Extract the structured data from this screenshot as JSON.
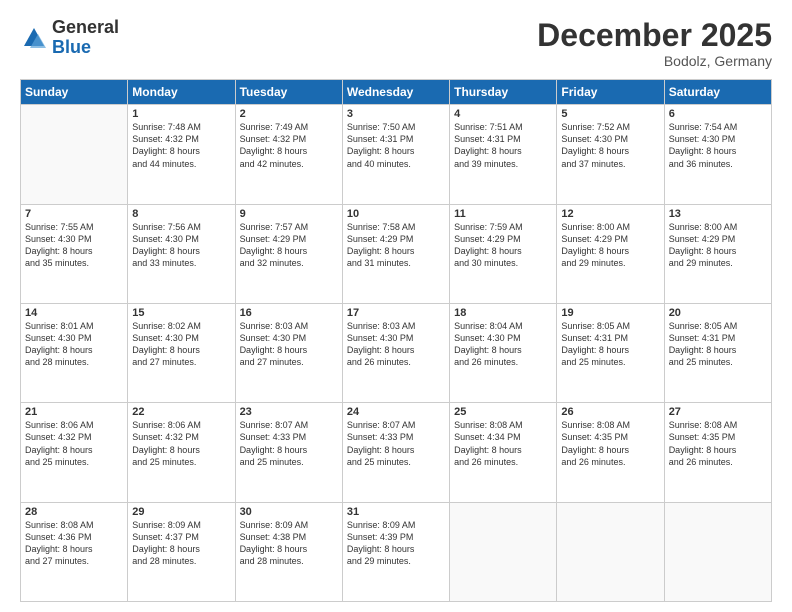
{
  "header": {
    "logo_general": "General",
    "logo_blue": "Blue",
    "month_title": "December 2025",
    "location": "Bodolz, Germany"
  },
  "days_of_week": [
    "Sunday",
    "Monday",
    "Tuesday",
    "Wednesday",
    "Thursday",
    "Friday",
    "Saturday"
  ],
  "weeks": [
    [
      {
        "day": "",
        "content": ""
      },
      {
        "day": "1",
        "content": "Sunrise: 7:48 AM\nSunset: 4:32 PM\nDaylight: 8 hours\nand 44 minutes."
      },
      {
        "day": "2",
        "content": "Sunrise: 7:49 AM\nSunset: 4:32 PM\nDaylight: 8 hours\nand 42 minutes."
      },
      {
        "day": "3",
        "content": "Sunrise: 7:50 AM\nSunset: 4:31 PM\nDaylight: 8 hours\nand 40 minutes."
      },
      {
        "day": "4",
        "content": "Sunrise: 7:51 AM\nSunset: 4:31 PM\nDaylight: 8 hours\nand 39 minutes."
      },
      {
        "day": "5",
        "content": "Sunrise: 7:52 AM\nSunset: 4:30 PM\nDaylight: 8 hours\nand 37 minutes."
      },
      {
        "day": "6",
        "content": "Sunrise: 7:54 AM\nSunset: 4:30 PM\nDaylight: 8 hours\nand 36 minutes."
      }
    ],
    [
      {
        "day": "7",
        "content": "Sunrise: 7:55 AM\nSunset: 4:30 PM\nDaylight: 8 hours\nand 35 minutes."
      },
      {
        "day": "8",
        "content": "Sunrise: 7:56 AM\nSunset: 4:30 PM\nDaylight: 8 hours\nand 33 minutes."
      },
      {
        "day": "9",
        "content": "Sunrise: 7:57 AM\nSunset: 4:29 PM\nDaylight: 8 hours\nand 32 minutes."
      },
      {
        "day": "10",
        "content": "Sunrise: 7:58 AM\nSunset: 4:29 PM\nDaylight: 8 hours\nand 31 minutes."
      },
      {
        "day": "11",
        "content": "Sunrise: 7:59 AM\nSunset: 4:29 PM\nDaylight: 8 hours\nand 30 minutes."
      },
      {
        "day": "12",
        "content": "Sunrise: 8:00 AM\nSunset: 4:29 PM\nDaylight: 8 hours\nand 29 minutes."
      },
      {
        "day": "13",
        "content": "Sunrise: 8:00 AM\nSunset: 4:29 PM\nDaylight: 8 hours\nand 29 minutes."
      }
    ],
    [
      {
        "day": "14",
        "content": "Sunrise: 8:01 AM\nSunset: 4:30 PM\nDaylight: 8 hours\nand 28 minutes."
      },
      {
        "day": "15",
        "content": "Sunrise: 8:02 AM\nSunset: 4:30 PM\nDaylight: 8 hours\nand 27 minutes."
      },
      {
        "day": "16",
        "content": "Sunrise: 8:03 AM\nSunset: 4:30 PM\nDaylight: 8 hours\nand 27 minutes."
      },
      {
        "day": "17",
        "content": "Sunrise: 8:03 AM\nSunset: 4:30 PM\nDaylight: 8 hours\nand 26 minutes."
      },
      {
        "day": "18",
        "content": "Sunrise: 8:04 AM\nSunset: 4:30 PM\nDaylight: 8 hours\nand 26 minutes."
      },
      {
        "day": "19",
        "content": "Sunrise: 8:05 AM\nSunset: 4:31 PM\nDaylight: 8 hours\nand 25 minutes."
      },
      {
        "day": "20",
        "content": "Sunrise: 8:05 AM\nSunset: 4:31 PM\nDaylight: 8 hours\nand 25 minutes."
      }
    ],
    [
      {
        "day": "21",
        "content": "Sunrise: 8:06 AM\nSunset: 4:32 PM\nDaylight: 8 hours\nand 25 minutes."
      },
      {
        "day": "22",
        "content": "Sunrise: 8:06 AM\nSunset: 4:32 PM\nDaylight: 8 hours\nand 25 minutes."
      },
      {
        "day": "23",
        "content": "Sunrise: 8:07 AM\nSunset: 4:33 PM\nDaylight: 8 hours\nand 25 minutes."
      },
      {
        "day": "24",
        "content": "Sunrise: 8:07 AM\nSunset: 4:33 PM\nDaylight: 8 hours\nand 25 minutes."
      },
      {
        "day": "25",
        "content": "Sunrise: 8:08 AM\nSunset: 4:34 PM\nDaylight: 8 hours\nand 26 minutes."
      },
      {
        "day": "26",
        "content": "Sunrise: 8:08 AM\nSunset: 4:35 PM\nDaylight: 8 hours\nand 26 minutes."
      },
      {
        "day": "27",
        "content": "Sunrise: 8:08 AM\nSunset: 4:35 PM\nDaylight: 8 hours\nand 26 minutes."
      }
    ],
    [
      {
        "day": "28",
        "content": "Sunrise: 8:08 AM\nSunset: 4:36 PM\nDaylight: 8 hours\nand 27 minutes."
      },
      {
        "day": "29",
        "content": "Sunrise: 8:09 AM\nSunset: 4:37 PM\nDaylight: 8 hours\nand 28 minutes."
      },
      {
        "day": "30",
        "content": "Sunrise: 8:09 AM\nSunset: 4:38 PM\nDaylight: 8 hours\nand 28 minutes."
      },
      {
        "day": "31",
        "content": "Sunrise: 8:09 AM\nSunset: 4:39 PM\nDaylight: 8 hours\nand 29 minutes."
      },
      {
        "day": "",
        "content": ""
      },
      {
        "day": "",
        "content": ""
      },
      {
        "day": "",
        "content": ""
      }
    ]
  ]
}
